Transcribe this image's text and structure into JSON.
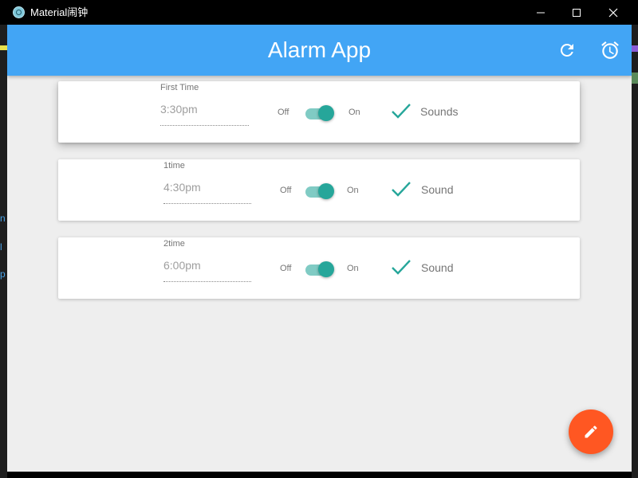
{
  "window": {
    "title": "Material闹钟"
  },
  "appbar": {
    "title": "Alarm App",
    "refresh_icon": "refresh-icon",
    "alarm_icon": "alarm-clock-icon",
    "color": "#42a5f5"
  },
  "alarms": [
    {
      "label": "First Time",
      "time": "3:30pm",
      "off_label": "Off",
      "on_label": "On",
      "enabled": true,
      "sound_checked": true,
      "sound_label": "Sounds"
    },
    {
      "label": "1time",
      "time": "4:30pm",
      "off_label": "Off",
      "on_label": "On",
      "enabled": true,
      "sound_checked": true,
      "sound_label": "Sound"
    },
    {
      "label": "2time",
      "time": "6:00pm",
      "off_label": "Off",
      "on_label": "On",
      "enabled": true,
      "sound_checked": true,
      "sound_label": "Sound"
    }
  ],
  "fab": {
    "icon": "pencil-icon",
    "color": "#ff5722"
  },
  "colors": {
    "accent": "#26a69a",
    "background": "#eeeeee"
  }
}
